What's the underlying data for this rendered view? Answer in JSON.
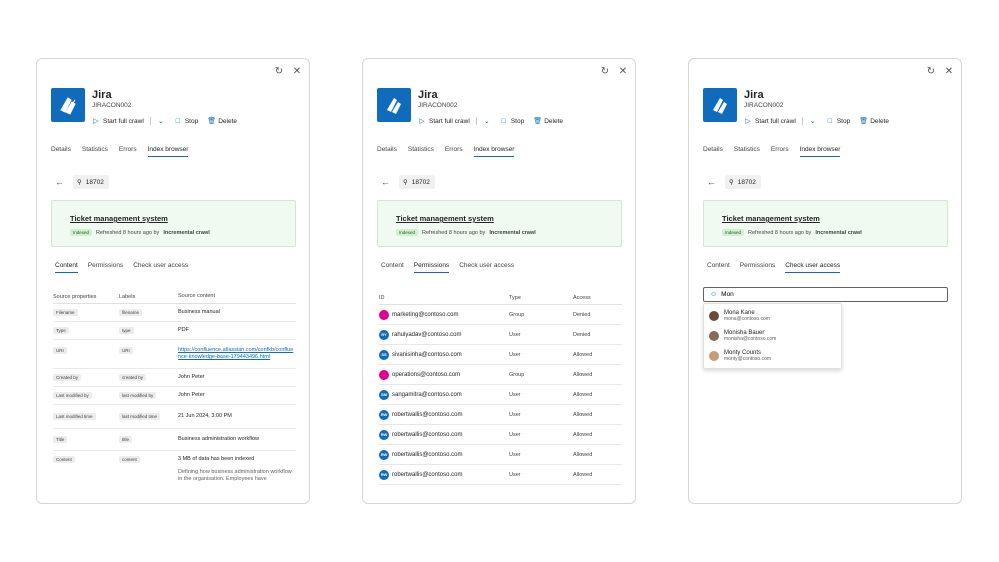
{
  "common": {
    "app_title": "Jira",
    "connection_id": "JIRACON002",
    "toolbar": {
      "start_crawl": "Start full crawl",
      "stop": "Stop",
      "delete": "Delete"
    },
    "tabs": [
      "Details",
      "Statistics",
      "Errors",
      "Index browser"
    ],
    "search_value": "18702",
    "banner": {
      "title": "Ticket management system",
      "badge": "Indexed",
      "meta_prefix": "Refreshed 8 hours ago by",
      "meta_bold": "Incremental crawl"
    },
    "subtabs": [
      "Content",
      "Permissions",
      "Check user access"
    ],
    "colors": {
      "accent": "#0f6cbd",
      "banner_bg": "#f1faf1",
      "badge_bg": "#d3eed3"
    }
  },
  "content_table": {
    "headers": [
      "Source properties",
      "Labels",
      "Source content"
    ],
    "rows": [
      {
        "prop": "Filename",
        "label": "filename",
        "value": "Business manual"
      },
      {
        "prop": "Type",
        "label": "type",
        "value": "PDF"
      },
      {
        "prop": "URI",
        "label": "URI",
        "value": "https://confluence.atlassian.com/confkb/confluence-knowledge-base-179443496.html"
      },
      {
        "prop": "Created by",
        "label": "created by",
        "value": "John Peter"
      },
      {
        "prop": "Last modified by",
        "label": "last modified by",
        "value": "John Peter"
      },
      {
        "prop": "Last modified time",
        "label": "last modified time",
        "value": "21 Jun 2024, 3:00 PM"
      },
      {
        "prop": "Title",
        "label": "title",
        "value": "Business administration workflow"
      },
      {
        "prop": "Content",
        "label": "content",
        "value": "3 MB of data has been indexed",
        "value2": "Defining how business administration workflow in the organisation. Employees have"
      }
    ]
  },
  "permissions_table": {
    "headers": [
      "ID",
      "Type",
      "Access"
    ],
    "rows": [
      {
        "initials": "",
        "color": "#e3008c",
        "id": "marketing@contoso.com",
        "type": "Group",
        "access": "Denied"
      },
      {
        "initials": "RY",
        "color": "#0f6cbd",
        "id": "rahulyadav@contoso.com",
        "type": "User",
        "access": "Denied"
      },
      {
        "initials": "SS",
        "color": "#0f6cbd",
        "id": "sivanisinha@contoso.com",
        "type": "User",
        "access": "Allowed"
      },
      {
        "initials": "",
        "color": "#e3008c",
        "id": "operations@contoso.com",
        "type": "Group",
        "access": "Allowed"
      },
      {
        "initials": "SM",
        "color": "#0f6cbd",
        "id": "sangamitra@contoso.com",
        "type": "User",
        "access": "Allowed"
      },
      {
        "initials": "RW",
        "color": "#0f6cbd",
        "id": "robertwallis@contoso.com",
        "type": "User",
        "access": "Allowed"
      },
      {
        "initials": "RW",
        "color": "#0f6cbd",
        "id": "robertwallis@contoso.com",
        "type": "User",
        "access": "Allowed"
      },
      {
        "initials": "RW",
        "color": "#0f6cbd",
        "id": "robertwallis@contoso.com",
        "type": "User",
        "access": "Allowed"
      },
      {
        "initials": "RW",
        "color": "#0f6cbd",
        "id": "robertwallis@contoso.com",
        "type": "User",
        "access": "Allowed"
      }
    ]
  },
  "user_access": {
    "input_value": "Mon",
    "suggestions": [
      {
        "name": "Mona Kane",
        "email": "mona@contoso.com",
        "avatar_color": "#6b4a3a"
      },
      {
        "name": "Monisha Bauer",
        "email": "monisha@contoso.com",
        "avatar_color": "#8a6a55"
      },
      {
        "name": "Monty Counts",
        "email": "monty@contoso.com",
        "avatar_color": "#c79a7a"
      }
    ]
  }
}
